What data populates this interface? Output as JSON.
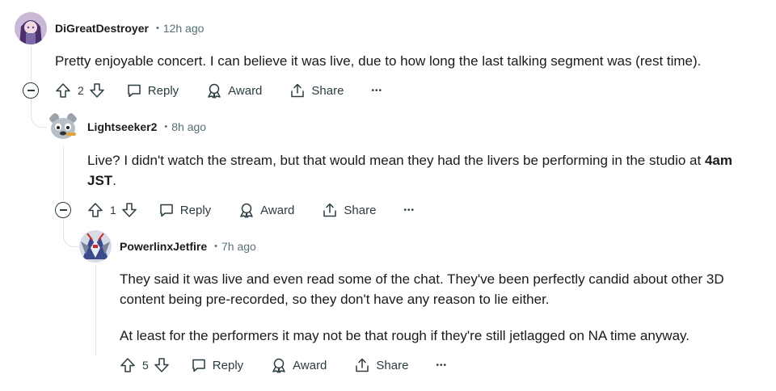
{
  "comments": [
    {
      "author": "DiGreatDestroyer",
      "time": "12h ago",
      "body": [
        "Pretty enjoyable concert. I can believe it was live, due to how long the last talking segment was (rest time)."
      ],
      "score": "2",
      "avatar_icon": "purple-anime-avatar"
    },
    {
      "author": "Lightseeker2",
      "time": "8h ago",
      "body_prefix": "Live? I didn't watch the stream, but that would mean they had the livers be performing in the studio at ",
      "body_bold": "4am JST",
      "body_suffix": ".",
      "score": "1",
      "avatar_icon": "snoo-mascot-avatar"
    },
    {
      "author": "PowerlinxJetfire",
      "time": "7h ago",
      "body": [
        "They said it was live and even read some of the chat. They've been perfectly candid about other 3D content being pre-recorded, so they don't have any reason to lie either.",
        "At least for the performers it may not be that rough if they're still jetlagged on NA time anyway."
      ],
      "score": "5",
      "avatar_icon": "mech-robot-avatar"
    }
  ],
  "actions": {
    "reply": "Reply",
    "award": "Award",
    "share": "Share",
    "more": "•••"
  },
  "colors": {
    "text": "#1a1a1b",
    "meta": "#576f76",
    "icon": "#2a3c42",
    "thread": "#e0e3e6"
  }
}
